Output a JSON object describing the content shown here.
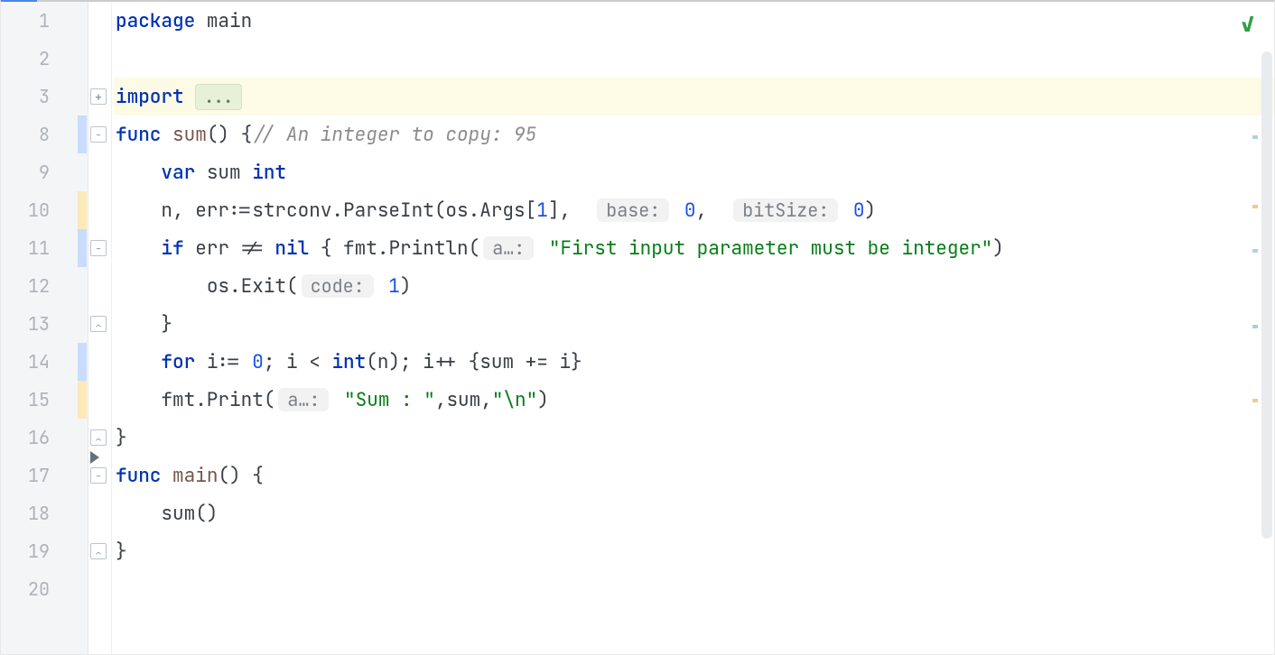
{
  "lineNumbers": [
    "1",
    "2",
    "3",
    "8",
    "9",
    "10",
    "11",
    "12",
    "13",
    "14",
    "15",
    "16",
    "17",
    "18",
    "19",
    "20"
  ],
  "code": {
    "l1": {
      "kw": "package",
      "pkg": "main"
    },
    "l3": {
      "kw": "import",
      "fold": "..."
    },
    "l8": {
      "kw": "func",
      "fn": "sum",
      "sig": "() {",
      "comment": "// An integer to copy: 95"
    },
    "l9": {
      "indent": "    ",
      "kw": "var",
      "ident": "sum",
      "typ": "int"
    },
    "l10": {
      "indent": "    ",
      "lhs": "n, err",
      "op": ":=",
      "call": "strconv.ParseInt",
      "args_pre": "(os.Args[",
      "idx": "1",
      "args_mid": "],  ",
      "hint1": "base:",
      "val1": "0",
      "mid2": ",  ",
      "hint2": "bitSize:",
      "val2": "0",
      "close": ")"
    },
    "l11": {
      "indent": "    ",
      "kw": "if",
      "cond": "err != ",
      "nil": "nil",
      "open": " { ",
      "call": "fmt.Println",
      "paren": "(",
      "hint": "a…:",
      "sp": " ",
      "str": "\"First input parameter must be integer\"",
      "close": ")"
    },
    "l12": {
      "indent": "        ",
      "call": "os.Exit",
      "paren": "(",
      "hint": "code:",
      "sp": " ",
      "val": "1",
      "close": ")"
    },
    "l13": {
      "indent": "    ",
      "brace": "}"
    },
    "l14": {
      "indent": "    ",
      "kw": "for",
      "body_a": " i:= ",
      "zero": "0",
      "body_b": "; i < ",
      "intcast": "int",
      "body_c": "(n); i++ {sum += i}"
    },
    "l15": {
      "indent": "    ",
      "call": "fmt.Print",
      "paren": "(",
      "hint": "a…:",
      "sp": " ",
      "str1": "\"Sum : \"",
      "mid": ",sum,",
      "str2": "\"\\n\"",
      "close": ")"
    },
    "l16": {
      "brace": "}"
    },
    "l17": {
      "kw": "func",
      "fn": "main",
      "sig": "() {"
    },
    "l18": {
      "indent": "    ",
      "call": "sum()"
    },
    "l19": {
      "brace": "}"
    }
  },
  "status": {
    "ok": "✓"
  }
}
